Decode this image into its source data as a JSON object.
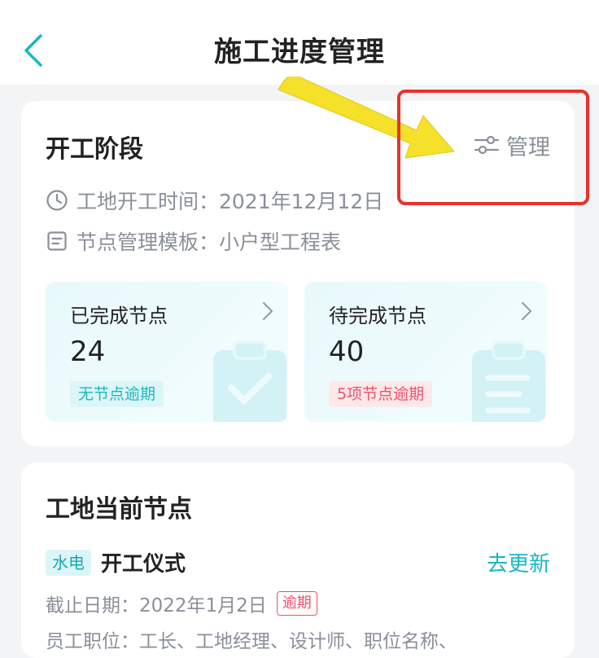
{
  "header": {
    "title": "施工进度管理"
  },
  "stage_card": {
    "title": "开工阶段",
    "manage_label": "管理",
    "start_time": "工地开工时间：2021年12月12日",
    "template": "节点管理模板：小户型工程表",
    "completed": {
      "label": "已完成节点",
      "value": "24",
      "badge": "无节点逾期"
    },
    "pending": {
      "label": "待完成节点",
      "value": "40",
      "badge": "5项节点逾期"
    }
  },
  "current_node_card": {
    "title": "工地当前节点",
    "tag": "水电",
    "node_name": "开工仪式",
    "update_label": "去更新",
    "deadline": "截止日期：2022年1月2日",
    "overdue_label": "逾期",
    "staff": "员工职位：工长、工地经理、设计师、职位名称、"
  },
  "colors": {
    "accent": "#1bb6c4",
    "danger": "#f0506a",
    "annotation_red": "#e8322c",
    "annotation_yellow": "#f5e02a"
  }
}
